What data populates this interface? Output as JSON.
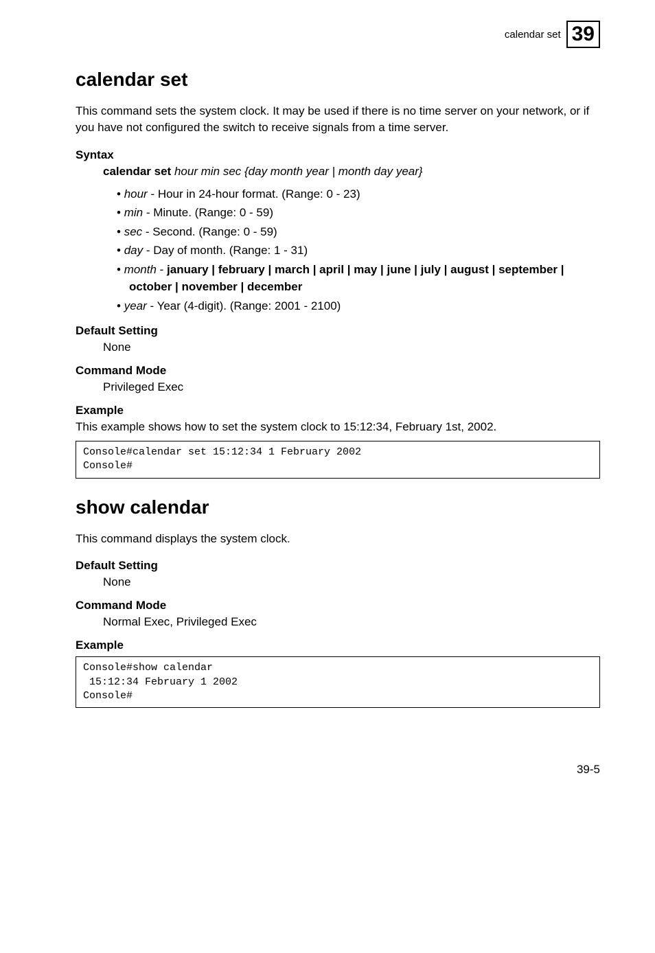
{
  "header": {
    "breadcrumb": "calendar set",
    "chapter": "39"
  },
  "section_calendar_set": {
    "title": "calendar set",
    "intro": "This command sets the system clock. It may be used if there is no time server on your network, or if you have not configured the switch to receive signals from a time server.",
    "syntax_head": "Syntax",
    "syntax_cmd": "calendar set",
    "syntax_args": " hour min sec {day month year | month day year}",
    "params": {
      "hour_name": "hour",
      "hour_desc": " - Hour in 24-hour format. (Range: 0 - 23)",
      "min_name": "min",
      "min_desc": " - Minute. (Range: 0 - 59)",
      "sec_name": "sec",
      "sec_desc": " - Second. (Range: 0 - 59)",
      "day_name": "day",
      "day_desc": " - Day of month. (Range: 1 - 31)",
      "month_name": "month",
      "month_desc_pre": " - ",
      "month_desc_options": "january | february | march | april | may | june | july | august | september | october | november | december",
      "year_name": "year",
      "year_desc": " - Year (4-digit). (Range: 2001 - 2100)"
    },
    "default_head": "Default Setting",
    "default_val": "None",
    "mode_head": "Command Mode",
    "mode_val": "Privileged Exec",
    "example_head": "Example",
    "example_text": "This example shows how to set the system clock to 15:12:34, February 1st, 2002.",
    "example_code": "Console#calendar set 15:12:34 1 February 2002\nConsole#"
  },
  "section_show_calendar": {
    "title": "show calendar",
    "intro": "This command displays the system clock.",
    "default_head": "Default Setting",
    "default_val": "None",
    "mode_head": "Command Mode",
    "mode_val": "Normal Exec, Privileged Exec",
    "example_head": "Example",
    "example_code": "Console#show calendar\n 15:12:34 February 1 2002\nConsole#"
  },
  "footer": {
    "page": "39-5"
  }
}
